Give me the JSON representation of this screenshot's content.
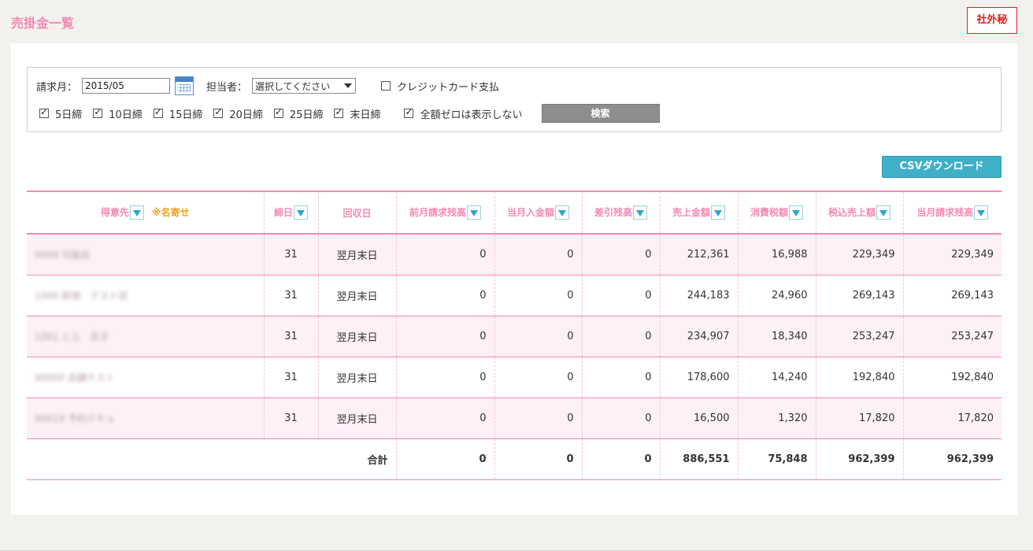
{
  "page": {
    "title": "売掛金一覧",
    "confidential_badge": "社外秘"
  },
  "filter": {
    "billing_month_label": "請求月：",
    "billing_month_value": "2015/05",
    "staff_label": "担当者：",
    "staff_selected": "選択してください",
    "credit_card_label": "クレジットカード支払",
    "credit_card_checked": false,
    "closing_days": [
      {
        "label": "5日締",
        "checked": true
      },
      {
        "label": "10日締",
        "checked": true
      },
      {
        "label": "15日締",
        "checked": true
      },
      {
        "label": "20日締",
        "checked": true
      },
      {
        "label": "25日締",
        "checked": true
      },
      {
        "label": "末日締",
        "checked": true
      }
    ],
    "hide_zero_label": "全額ゼロは表示しない",
    "hide_zero_checked": true,
    "search_button": "検索"
  },
  "csv_button": "CSVダウンロード",
  "table": {
    "headers": {
      "customer": "得意先",
      "name_match": "※名寄せ",
      "closing_day": "締日",
      "collection_day": "回収日",
      "prev_balance": "前月請求残高",
      "received": "当月入金額",
      "diff_balance": "差引残高",
      "sales": "売上金額",
      "tax": "消費税額",
      "sales_incl_tax": "税込売上額",
      "current_balance": "当月請求残高"
    },
    "rows": [
      {
        "customer": "9999 可能店",
        "closing_day": "31",
        "collection_day": "翌月末日",
        "prev_balance": "0",
        "received": "0",
        "diff_balance": "0",
        "sales": "212,361",
        "tax": "16,988",
        "sales_incl_tax": "229,349",
        "current_balance": "229,349"
      },
      {
        "customer": "1000 新宿　テスト店",
        "closing_day": "31",
        "collection_day": "翌月末日",
        "prev_balance": "0",
        "received": "0",
        "diff_balance": "0",
        "sales": "244,183",
        "tax": "24,960",
        "sales_incl_tax": "269,143",
        "current_balance": "269,143"
      },
      {
        "customer": "1001 とら　花子",
        "closing_day": "31",
        "collection_day": "翌月末日",
        "prev_balance": "0",
        "received": "0",
        "diff_balance": "0",
        "sales": "234,907",
        "tax": "18,340",
        "sales_incl_tax": "253,247",
        "current_balance": "253,247"
      },
      {
        "customer": "90000 店舗テスト",
        "closing_day": "31",
        "collection_day": "翌月末日",
        "prev_balance": "0",
        "received": "0",
        "diff_balance": "0",
        "sales": "178,600",
        "tax": "14,240",
        "sales_incl_tax": "192,840",
        "current_balance": "192,840"
      },
      {
        "customer": "90019 予約テキュ",
        "closing_day": "31",
        "collection_day": "翌月末日",
        "prev_balance": "0",
        "received": "0",
        "diff_balance": "0",
        "sales": "16,500",
        "tax": "1,320",
        "sales_incl_tax": "17,820",
        "current_balance": "17,820"
      }
    ],
    "total": {
      "label": "合計",
      "prev_balance": "0",
      "received": "0",
      "diff_balance": "0",
      "sales": "886,551",
      "tax": "75,848",
      "sales_incl_tax": "962,399",
      "current_balance": "962,399"
    }
  },
  "colors": {
    "accent_pink": "#f28ab4",
    "csv_button": "#3fb0c8",
    "name_match": "#f0a020",
    "confidential": "#e02020"
  }
}
